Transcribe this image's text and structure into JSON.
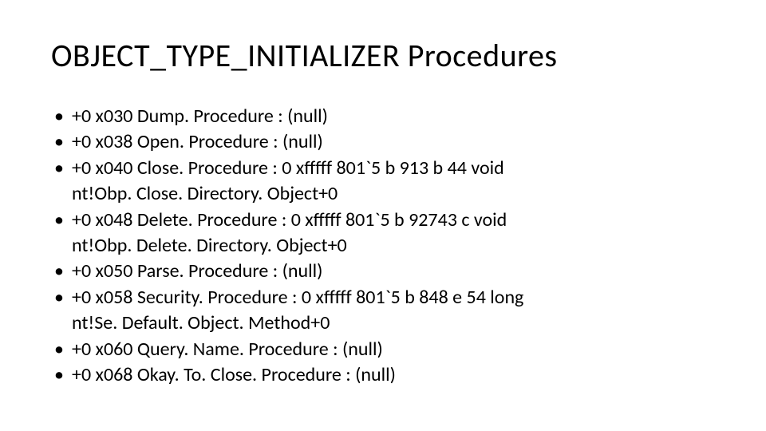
{
  "title": "OBJECT_TYPE_INITIALIZER Procedures",
  "items": [
    {
      "line": "+0 x030 Dump. Procedure    : (null)",
      "cont": ""
    },
    {
      "line": "   +0 x038 Open. Procedure    : (null)",
      "cont": ""
    },
    {
      "line": "   +0 x040 Close. Procedure   : 0 xfffff 801`5 b 913 b 44     void ",
      "cont": "nt!Obp. Close. Directory. Object+0"
    },
    {
      "line": "   +0 x048 Delete. Procedure  : 0 xfffff 801`5 b 92743 c     void ",
      "cont": "nt!Obp. Delete. Directory. Object+0"
    },
    {
      "line": "   +0 x050 Parse. Procedure   : (null)",
      "cont": ""
    },
    {
      "line": "   +0 x058 Security. Procedure : 0 xfffff 801`5 b 848 e 54     long ",
      "cont": "nt!Se. Default. Object. Method+0"
    },
    {
      "line": "   +0 x060 Query. Name. Procedure : (null)",
      "cont": ""
    },
    {
      "line": "   +0 x068 Okay. To. Close. Procedure : (null)",
      "cont": ""
    }
  ]
}
